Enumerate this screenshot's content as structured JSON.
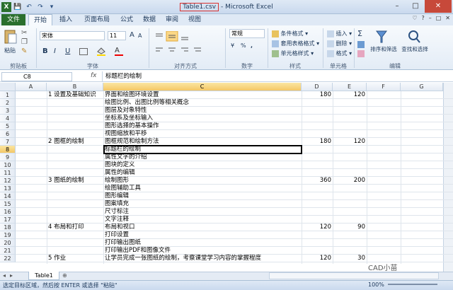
{
  "window": {
    "title_file": "Table1.csv",
    "title_app": " - Microsoft Excel",
    "controls": [
      "–",
      "□",
      "✕"
    ]
  },
  "qat": [
    "💾",
    "↶",
    "↷",
    "▾"
  ],
  "tabs": [
    "文件",
    "开始",
    "插入",
    "页面布局",
    "公式",
    "数据",
    "审阅",
    "视图"
  ],
  "tab_icons": [
    "♡",
    "?",
    "–",
    "□",
    "✕"
  ],
  "ribbon": {
    "clipboard": {
      "paste": "粘贴",
      "label": "剪贴板"
    },
    "font": {
      "name": "宋体",
      "size": "11",
      "label": "字体",
      "bold": "B",
      "italic": "I",
      "underline": "U",
      "grow": "A",
      "shrink": "A"
    },
    "alignment": {
      "label": "对齐方式"
    },
    "number": {
      "format": "常规",
      "label": "数字",
      "percent": "%",
      "comma": ",",
      "currency": "¥"
    },
    "styles": {
      "conditional": "条件格式",
      "table_format": "套用表格格式",
      "cell_styles": "单元格样式",
      "label": "样式"
    },
    "cells": {
      "insert": "插入",
      "delete": "删除",
      "format": "格式",
      "label": "单元格"
    },
    "editing": {
      "sum": "Σ",
      "sort_filter": "排序和筛选",
      "find_select": "查找和选择",
      "label": "编辑"
    }
  },
  "formula_bar": {
    "name_box": "C8",
    "fx": "fx",
    "content": "标题栏的绘制"
  },
  "columns": [
    "A",
    "B",
    "C",
    "D",
    "E",
    "F",
    "G"
  ],
  "rows": [
    {
      "n": "1",
      "a": "",
      "b": "1 设置及基础知识",
      "c": "界面和绘图环境设置",
      "d": "180",
      "e": "120"
    },
    {
      "n": "2",
      "a": "",
      "b": "",
      "c": "绘图比例、出图比例等相关概念",
      "d": "",
      "e": ""
    },
    {
      "n": "3",
      "a": "",
      "b": "",
      "c": "图层及对象特性",
      "d": "",
      "e": ""
    },
    {
      "n": "4",
      "a": "",
      "b": "",
      "c": "坐标系及坐标输入",
      "d": "",
      "e": ""
    },
    {
      "n": "5",
      "a": "",
      "b": "",
      "c": "图形选择的基本操作",
      "d": "",
      "e": ""
    },
    {
      "n": "6",
      "a": "",
      "b": "",
      "c": "视图缩放和平移",
      "d": "",
      "e": ""
    },
    {
      "n": "7",
      "a": "",
      "b": "2 图框的绘制",
      "c": "图框规范和绘制方法",
      "d": "180",
      "e": "120"
    },
    {
      "n": "8",
      "a": "",
      "b": "",
      "c": "标题栏的绘制",
      "d": "",
      "e": ""
    },
    {
      "n": "9",
      "a": "",
      "b": "",
      "c": "属性文字的介绍",
      "d": "",
      "e": ""
    },
    {
      "n": "10",
      "a": "",
      "b": "",
      "c": "图块的定义",
      "d": "",
      "e": ""
    },
    {
      "n": "11",
      "a": "",
      "b": "",
      "c": "属性的编辑",
      "d": "",
      "e": ""
    },
    {
      "n": "12",
      "a": "",
      "b": "3 图纸的绘制",
      "c": "绘制图形",
      "d": "360",
      "e": "200"
    },
    {
      "n": "13",
      "a": "",
      "b": "",
      "c": "绘图辅助工具",
      "d": "",
      "e": ""
    },
    {
      "n": "14",
      "a": "",
      "b": "",
      "c": "图形编辑",
      "d": "",
      "e": ""
    },
    {
      "n": "15",
      "a": "",
      "b": "",
      "c": "图案填充",
      "d": "",
      "e": ""
    },
    {
      "n": "16",
      "a": "",
      "b": "",
      "c": "尺寸标注",
      "d": "",
      "e": ""
    },
    {
      "n": "17",
      "a": "",
      "b": "",
      "c": "文字注释",
      "d": "",
      "e": ""
    },
    {
      "n": "18",
      "a": "",
      "b": "4 布局和打印",
      "c": "布局和视口",
      "d": "120",
      "e": "90"
    },
    {
      "n": "19",
      "a": "",
      "b": "",
      "c": "打印设置",
      "d": "",
      "e": ""
    },
    {
      "n": "20",
      "a": "",
      "b": "",
      "c": "打印输出图纸",
      "d": "",
      "e": ""
    },
    {
      "n": "21",
      "a": "",
      "b": "",
      "c": "打印输出PDF和图像文件",
      "d": "",
      "e": ""
    },
    {
      "n": "22",
      "a": "",
      "b": "5 作业",
      "c": "让学员完成一张图纸的绘制，考察课堂学习内容的掌握程度",
      "d": "120",
      "e": "30"
    }
  ],
  "sheet_tabs": {
    "nav": [
      "◂",
      "▸"
    ],
    "active": "Table1",
    "new": "⊕"
  },
  "status": {
    "message": "选定目标区域，然后按 ENTER 或选择 \"粘贴\"",
    "zoom": "100%",
    "watermark": "CAD小苗"
  },
  "colors": {
    "file_tab": "#2a6f2e",
    "selection": "#f4c766",
    "title_highlight": "#d9302f"
  }
}
